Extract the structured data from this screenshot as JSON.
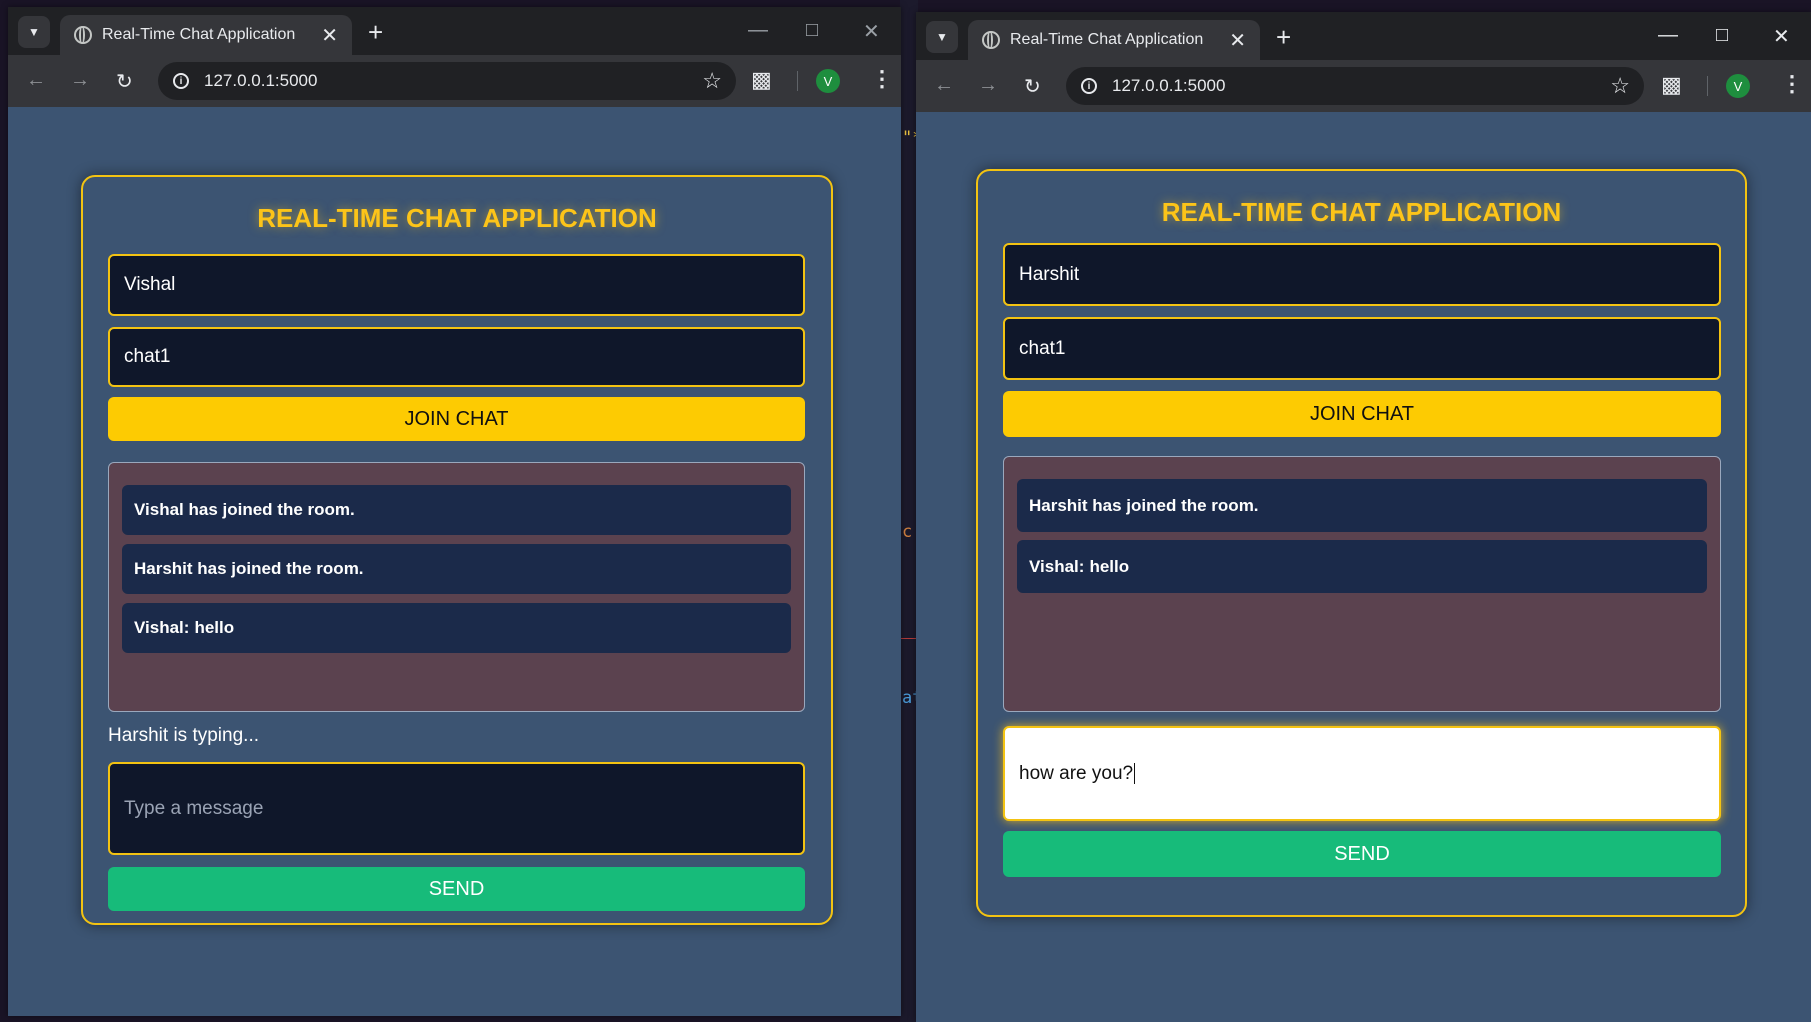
{
  "windows": [
    {
      "tab_title": "Real-Time Chat Application",
      "url": "127.0.0.1:5000",
      "profile_initial": "V",
      "app": {
        "title": "REAL-TIME CHAT APPLICATION",
        "username": "Vishal",
        "room": "chat1",
        "join_label": "JOIN CHAT",
        "messages": [
          {
            "text": "Vishal has joined the room."
          },
          {
            "text": "Harshit has joined the room."
          },
          {
            "sender": "Vishal:",
            "text": "hello"
          }
        ],
        "typing_indicator": "Harshit is typing...",
        "message_input_value": "",
        "message_placeholder": "Type a message",
        "send_label": "SEND"
      }
    },
    {
      "tab_title": "Real-Time Chat Application",
      "url": "127.0.0.1:5000",
      "profile_initial": "V",
      "app": {
        "title": "REAL-TIME CHAT APPLICATION",
        "username": "Harshit",
        "room": "chat1",
        "join_label": "JOIN CHAT",
        "messages": [
          {
            "text": "Harshit has joined the room."
          },
          {
            "sender": "Vishal:",
            "text": "hello"
          }
        ],
        "message_input_value": "how are you?",
        "send_label": "SEND"
      }
    }
  ],
  "colors": {
    "accent_yellow": "#fcc419",
    "send_green": "#17bb7a",
    "page_bg": "#3c5472",
    "input_bg": "#0f172a",
    "message_bubble": "#1b2a4a",
    "message_area": "#5b424f"
  }
}
